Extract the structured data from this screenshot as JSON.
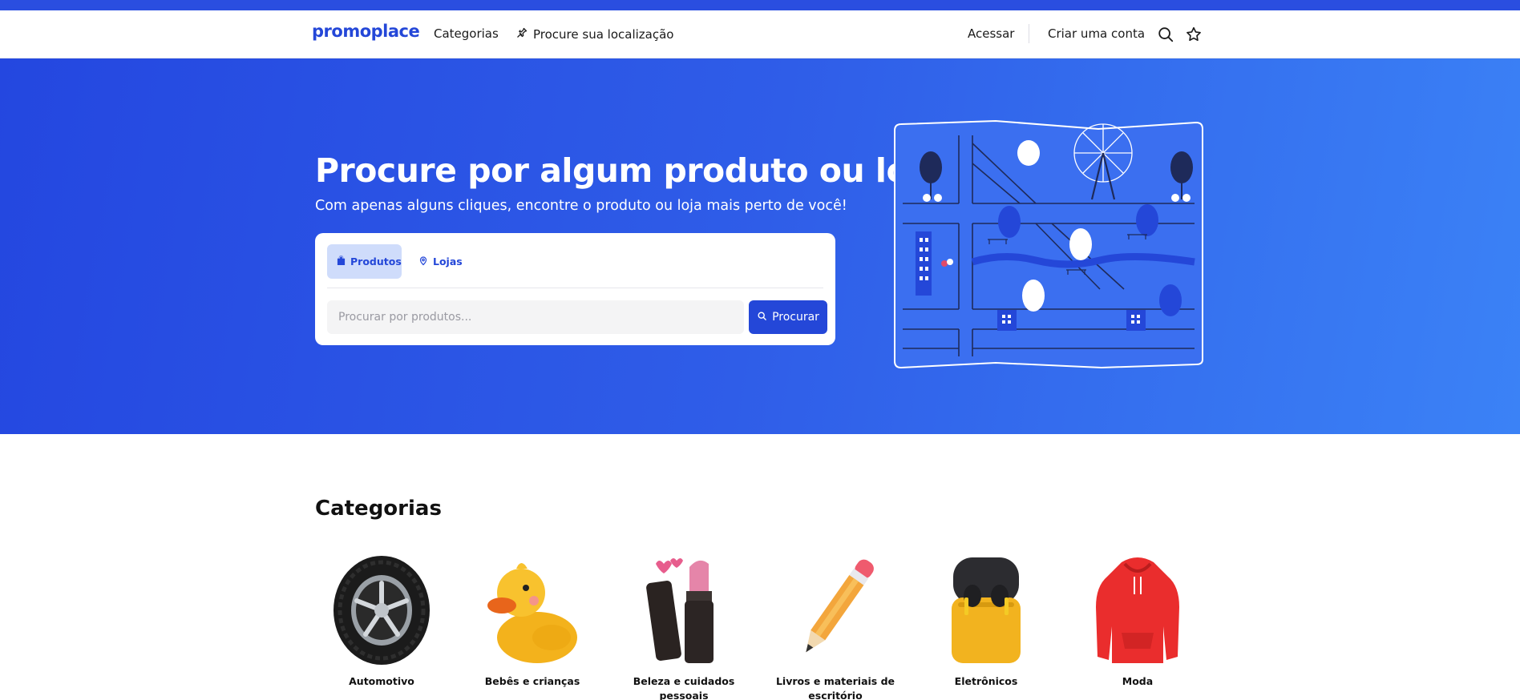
{
  "nav": {
    "brand": "promoplace",
    "categories": "Categorias",
    "location": "Procure sua localização",
    "login": "Acessar",
    "signup": "Criar uma conta"
  },
  "hero": {
    "title": "Procure por algum produto ou loja",
    "subtitle": "Com apenas alguns cliques, encontre o produto ou loja mais perto de você!",
    "tabs": [
      {
        "label": "Produtos",
        "icon": "bag-icon",
        "active": true
      },
      {
        "label": "Lojas",
        "icon": "map-pin-icon",
        "active": false
      }
    ],
    "search": {
      "placeholder": "Procurar por produtos...",
      "button": "Procurar"
    }
  },
  "categories_section": {
    "title": "Categorias",
    "items": [
      {
        "label": "Automotivo",
        "icon": "tire-icon"
      },
      {
        "label": "Bebês e crianças",
        "icon": "rubber-duck-icon"
      },
      {
        "label": "Beleza e cuidados pessoais",
        "icon": "lipstick-icon"
      },
      {
        "label": "Livros e materiais de escritório",
        "icon": "pencil-icon"
      },
      {
        "label": "Eletrônicos",
        "icon": "earbuds-icon"
      },
      {
        "label": "Moda",
        "icon": "hoodie-icon"
      }
    ]
  },
  "colors": {
    "primary": "#2447d8",
    "hero_start": "#2447e0",
    "hero_end": "#3b82f6",
    "tab_active_bg": "#cfdcfb"
  }
}
